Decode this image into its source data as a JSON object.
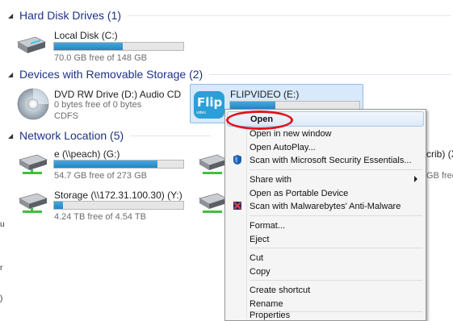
{
  "groups": {
    "hdd": {
      "label": "Hard Disk Drives (1)"
    },
    "removable": {
      "label": "Devices with Removable Storage (2)"
    },
    "network": {
      "label": "Network Location (5)"
    }
  },
  "drives": {
    "local_c": {
      "name": "Local Disk (C:)",
      "free": "70.0 GB free of 148 GB",
      "used_fraction": 0.53,
      "icon": "hard-drive-icon"
    },
    "dvd_d": {
      "name": "DVD RW Drive (D:) Audio CD",
      "free": "0 bytes free of 0 bytes",
      "fs": "CDFS",
      "icon": "cd-disc-icon"
    },
    "flip_e": {
      "name": "FLIPVIDEO (E:)",
      "used_fraction": 0.35,
      "icon": "flip-video-icon",
      "logo_text": "Flip",
      "logo_sub": "video"
    },
    "peach_g": {
      "name": "e (\\\\peach) (G:)",
      "free": "54.7 GB free of 273 GB",
      "used_fraction": 0.8,
      "icon": "network-drive-icon"
    },
    "storage_y": {
      "name": "Storage (\\\\172.31.100.30) (Y:)",
      "free": "4.24 TB free of 4.54 TB",
      "used_fraction": 0.07,
      "icon": "network-drive-icon"
    },
    "crib_x": {
      "name_fragment": "crib) (X",
      "free_fragment": "GB free o",
      "icon": "network-drive-icon"
    }
  },
  "context_menu": {
    "items": [
      {
        "label": "Open",
        "bold": true,
        "highlighted": true
      },
      {
        "label": "Open in new window"
      },
      {
        "label": "Open AutoPlay..."
      },
      {
        "label": "Scan with Microsoft Security Essentials...",
        "icon": "security-essentials-icon"
      },
      {
        "label": "Share with",
        "submenu": true
      },
      {
        "label": "Open as Portable Device"
      },
      {
        "label": "Scan with Malwarebytes' Anti-Malware",
        "icon": "malwarebytes-icon"
      },
      {
        "label": "Format..."
      },
      {
        "label": "Eject"
      },
      {
        "label": "Cut"
      },
      {
        "label": "Copy"
      },
      {
        "label": "Create shortcut"
      },
      {
        "label": "Rename"
      },
      {
        "label": "Properties"
      }
    ]
  },
  "left_edge_chars": [
    "u",
    "r",
    ")"
  ],
  "colors": {
    "accent": "#2683c5",
    "header": "#1e3287",
    "highlight_ring": "#e0151e"
  }
}
